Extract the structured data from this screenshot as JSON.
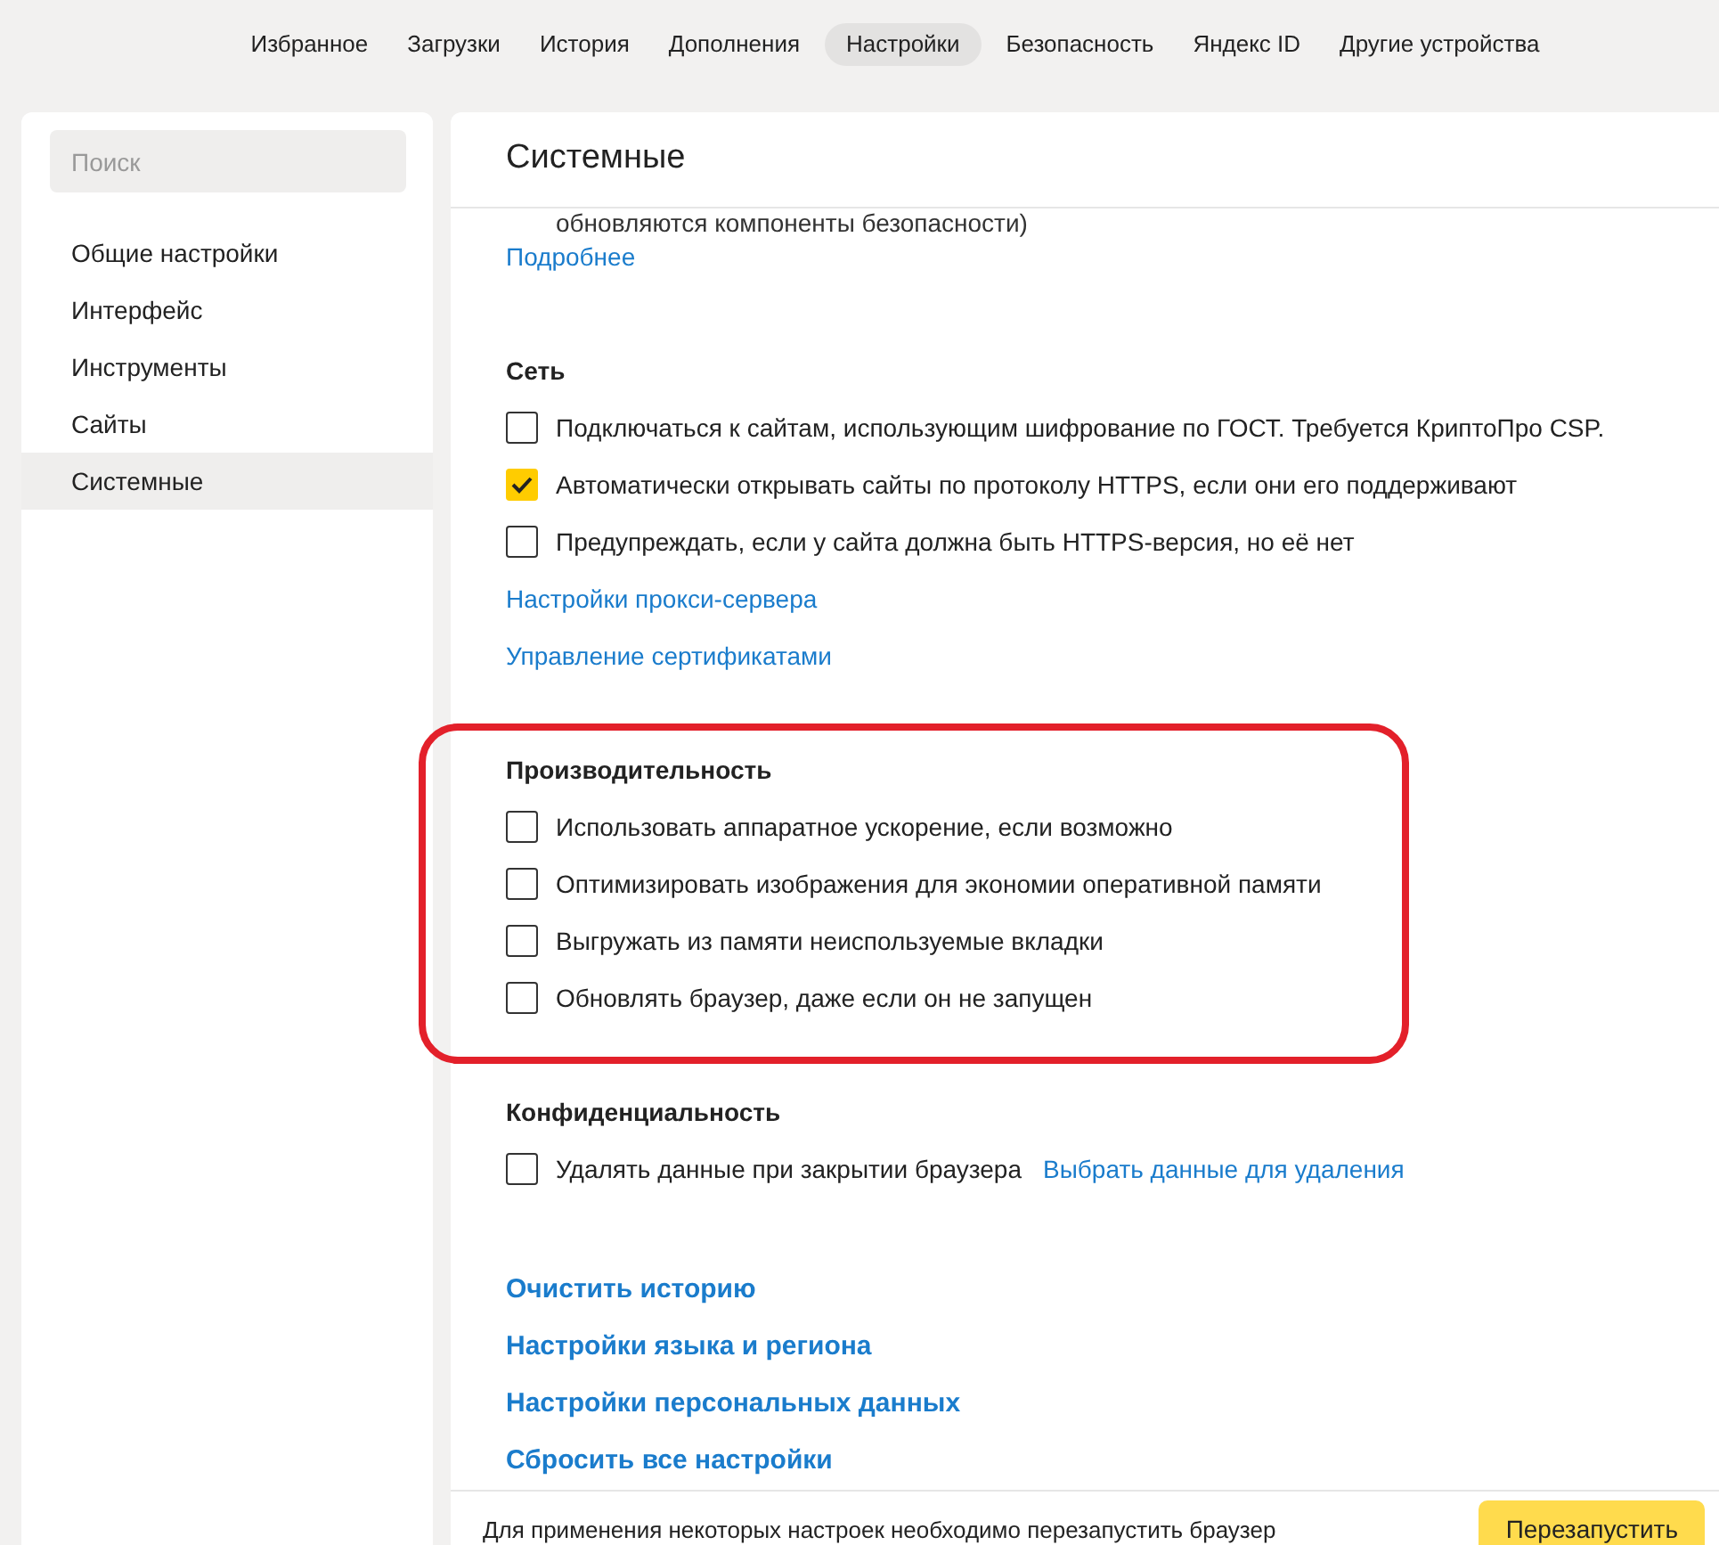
{
  "nav": [
    {
      "label": "Избранное",
      "selected": false
    },
    {
      "label": "Загрузки",
      "selected": false
    },
    {
      "label": "История",
      "selected": false
    },
    {
      "label": "Дополнения",
      "selected": false
    },
    {
      "label": "Настройки",
      "selected": true
    },
    {
      "label": "Безопасность",
      "selected": false
    },
    {
      "label": "Яндекс ID",
      "selected": false
    },
    {
      "label": "Другие устройства",
      "selected": false
    }
  ],
  "sidebar": {
    "search": {
      "placeholder": "Поиск"
    },
    "items": [
      {
        "label": "Общие настройки",
        "selected": false
      },
      {
        "label": "Интерфейс",
        "selected": false
      },
      {
        "label": "Инструменты",
        "selected": false
      },
      {
        "label": "Сайты",
        "selected": false
      },
      {
        "label": "Системные",
        "selected": true
      }
    ]
  },
  "main": {
    "title": "Системные",
    "sections": [
      {
        "items": [
          {
            "kind": "text",
            "label": "обновляются компоненты безопасности)"
          },
          {
            "kind": "link",
            "label": "Подробнее"
          }
        ]
      },
      {
        "heading": "Сеть",
        "items": [
          {
            "kind": "checkbox",
            "label": "Подключаться к сайтам, использующим шифрование по ГОСТ. Требуется КриптоПро CSP.",
            "checked": false
          },
          {
            "kind": "checkbox",
            "label": "Автоматически открывать сайты по протоколу HTTPS, если они его поддерживают",
            "checked": true
          },
          {
            "kind": "checkbox",
            "label": "Предупреждать, если у сайта должна быть HTTPS-версия, но её нет",
            "checked": false
          },
          {
            "kind": "link",
            "label": "Настройки прокси-сервера"
          },
          {
            "kind": "link",
            "label": "Управление сертификатами"
          }
        ]
      },
      {
        "heading": "Производительность",
        "highlighted": true,
        "items": [
          {
            "kind": "checkbox",
            "label": "Использовать аппаратное ускорение, если возможно",
            "checked": false
          },
          {
            "kind": "checkbox",
            "label": "Оптимизировать изображения для экономии оперативной памяти",
            "checked": false
          },
          {
            "kind": "checkbox",
            "label": "Выгружать из памяти неиспользуемые вкладки",
            "checked": false
          },
          {
            "kind": "checkbox",
            "label": "Обновлять браузер, даже если он не запущен",
            "checked": false
          }
        ]
      },
      {
        "heading": "Конфиденциальность",
        "items": [
          {
            "kind": "checkbox",
            "label": "Удалять данные при закрытии браузера",
            "checked": false,
            "link": "Выбрать данные для удаления"
          }
        ]
      },
      {
        "items": [
          {
            "kind": "big_link",
            "label": "Очистить историю"
          },
          {
            "kind": "big_link",
            "label": "Настройки языка и региона"
          },
          {
            "kind": "big_link",
            "label": "Настройки персональных данных"
          },
          {
            "kind": "big_link",
            "label": "Сбросить все настройки"
          }
        ]
      }
    ]
  },
  "footer": {
    "message": "Для применения некоторых настроек необходимо перезапустить браузер",
    "button": "Перезапустить"
  }
}
